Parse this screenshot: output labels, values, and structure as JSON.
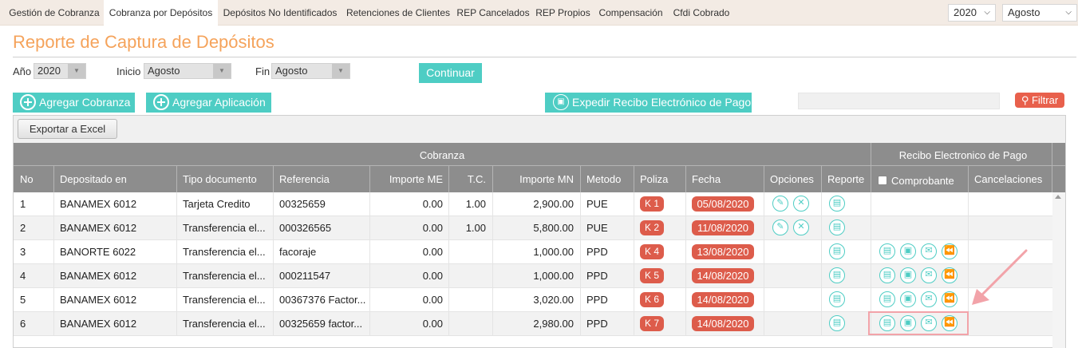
{
  "tabs": [
    "Gestión de Cobranza",
    "Cobranza por Depósitos",
    "Depósitos No Identificados",
    "Retenciones de Clientes",
    "REP Cancelados",
    "REP Propios",
    "Compensación",
    "Cfdi Cobrado"
  ],
  "top": {
    "year": "2020",
    "month": "Agosto"
  },
  "page_title": "Reporte de Captura de Depósitos",
  "filters": {
    "year_label": "Año",
    "year_value": "2020",
    "start_label": "Inicio",
    "start_value": "Agosto",
    "end_label": "Fin",
    "end_value": "Agosto",
    "continue": "Continuar"
  },
  "actions": {
    "add_cobranza": "Agregar Cobranza",
    "add_aplicacion": "Agregar Aplicación",
    "expedir": "Expedir Recibo Electrónico de Pago",
    "filtrar": "Filtrar",
    "export": "Exportar a Excel"
  },
  "group_headers": {
    "cobranza": "Cobranza",
    "recibo": "Recibo Electronico de Pago"
  },
  "columns": [
    "No",
    "Depositado en",
    "Tipo documento",
    "Referencia",
    "Importe ME",
    "T.C.",
    "Importe MN",
    "Metodo",
    "Poliza",
    "Fecha",
    "Opciones",
    "Reporte",
    "Comprobante",
    "Cancelaciones"
  ],
  "rows": [
    {
      "no": "1",
      "dep": "BANAMEX 6012",
      "tipo": "Tarjeta Credito",
      "ref": "00325659",
      "me": "0.00",
      "tc": "1.00",
      "mn": "2,900.00",
      "met": "PUE",
      "pol": "K 1",
      "fecha": "05/08/2020"
    },
    {
      "no": "2",
      "dep": "BANAMEX 6012",
      "tipo": "Transferencia el...",
      "ref": "000326565",
      "me": "0.00",
      "tc": "1.00",
      "mn": "5,800.00",
      "met": "PUE",
      "pol": "K 2",
      "fecha": "11/08/2020"
    },
    {
      "no": "3",
      "dep": "BANORTE 6022",
      "tipo": "Transferencia el...",
      "ref": "facoraje",
      "me": "0.00",
      "tc": "",
      "mn": "1,000.00",
      "met": "PPD",
      "pol": "K 4",
      "fecha": "13/08/2020"
    },
    {
      "no": "4",
      "dep": "BANAMEX 6012",
      "tipo": "Transferencia el...",
      "ref": "000211547",
      "me": "0.00",
      "tc": "",
      "mn": "1,000.00",
      "met": "PPD",
      "pol": "K 5",
      "fecha": "14/08/2020"
    },
    {
      "no": "5",
      "dep": "BANAMEX 6012",
      "tipo": "Transferencia el...",
      "ref": "00367376 Factor...",
      "me": "0.00",
      "tc": "",
      "mn": "3,020.00",
      "met": "PPD",
      "pol": "K 6",
      "fecha": "14/08/2020"
    },
    {
      "no": "6",
      "dep": "BANAMEX 6012",
      "tipo": "Transferencia el...",
      "ref": "00325659 factor...",
      "me": "0.00",
      "tc": "",
      "mn": "2,980.00",
      "met": "PPD",
      "pol": "K 7",
      "fecha": "14/08/2020"
    }
  ]
}
